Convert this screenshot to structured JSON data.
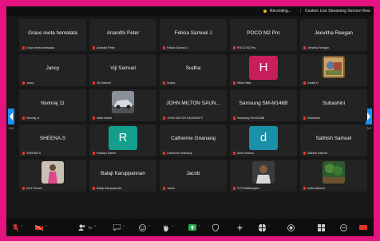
{
  "topbar": {
    "recording": "Recording...",
    "separator": "|",
    "streaming": "Custom Live Streaming Service",
    "view": "View"
  },
  "nav": {
    "left_page": "2/4",
    "right_page": "2/4"
  },
  "tiles": [
    {
      "name": "Grace reeta hemalata",
      "label": "Grace reeta hemalata"
    },
    {
      "name": "Anandhi Peter",
      "label": "Anandhi Peter"
    },
    {
      "name": "Felicia Samuel J",
      "label": "Felicia Samuel J"
    },
    {
      "name": "POCO M2 Pro",
      "label": "POCO M2 Pro"
    },
    {
      "name": "Jeevitha Reegan",
      "label": "Jeevitha Reegan"
    },
    {
      "name": "Jancy",
      "label": "Jancy"
    },
    {
      "name": "Viji Samuel",
      "label": "Viji Samuel"
    },
    {
      "name": "Sudha",
      "label": "Sudha"
    },
    {
      "name": "",
      "label": "Hilda Hilda",
      "avatar": "H",
      "avatar_color": "#c81e5b"
    },
    {
      "name": "",
      "label": "Daniel D",
      "photo": "painting"
    },
    {
      "name": "Nivinraj 11",
      "label": "Nivinraj 11"
    },
    {
      "name": "",
      "label": "dallin daniel",
      "photo": "car"
    },
    {
      "name": "JOHN MILTON SAUN...",
      "label": "JOHN MILTON SAUNDATTI"
    },
    {
      "name": "Samsung SM-M146B",
      "label": "Samsung SM-M146B"
    },
    {
      "name": "Subashini",
      "label": "Subashini"
    },
    {
      "name": "SHEENA.S",
      "label": "SHEENA.S"
    },
    {
      "name": "",
      "label": "Rosslyn Daniel",
      "avatar": "R",
      "avatar_color": "#149f8c"
    },
    {
      "name": "Catherine Gnanaraj",
      "label": "Catherine Gnanaraj"
    },
    {
      "name": "",
      "label": "dorin monica",
      "avatar": "d",
      "avatar_color": "#1a8fa8"
    },
    {
      "name": "Sathish Samuel",
      "label": "Sathish Samuel"
    },
    {
      "name": "",
      "label": "Devi Raman",
      "photo": "child"
    },
    {
      "name": "Balaji Karuppannan",
      "label": "Balaji Karuppannan"
    },
    {
      "name": "Jacob",
      "label": "Jacob"
    },
    {
      "name": "",
      "label": "S R Kolitthangam",
      "photo": "man"
    },
    {
      "name": "",
      "label": "Indira Manuel",
      "photo": "nature"
    }
  ],
  "toolbar": {
    "participants_count": "70"
  }
}
